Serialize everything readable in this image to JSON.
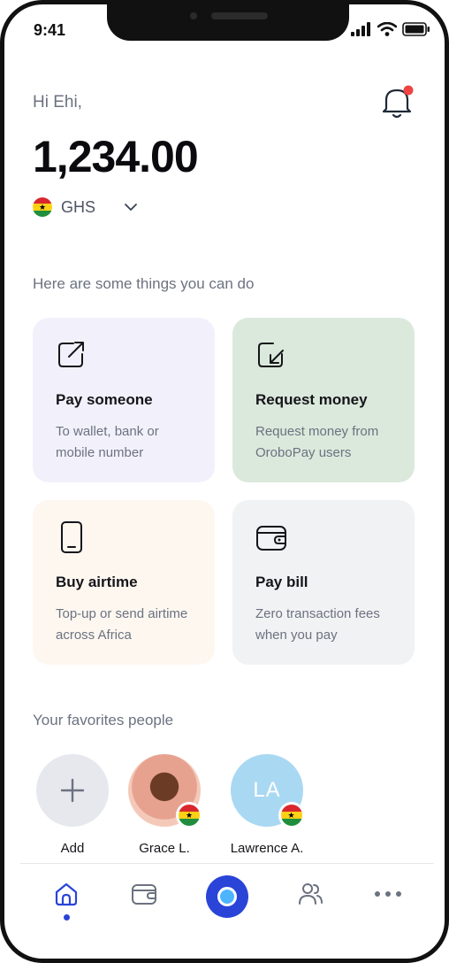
{
  "status_bar": {
    "time": "9:41"
  },
  "header": {
    "greeting": "Hi Ehi,",
    "balance": "1,234.00",
    "currency": "GHS"
  },
  "actions": {
    "title": "Here are some things you can do",
    "items": [
      {
        "title": "Pay someone",
        "description": "To wallet, bank or mobile number",
        "icon": "send-arrow-icon",
        "color": "#f2f1fb"
      },
      {
        "title": "Request money",
        "description": "Request money from OroboPay users",
        "icon": "receive-arrow-icon",
        "color": "#dbe9dc"
      },
      {
        "title": "Buy airtime",
        "description": "Top-up or send airtime across Africa",
        "icon": "phone-icon",
        "color": "#fdf7f0"
      },
      {
        "title": "Pay bill",
        "description": "Zero transaction fees when you pay",
        "icon": "wallet-icon",
        "color": "#f1f2f4"
      }
    ]
  },
  "favorites": {
    "title": "Your favorites people",
    "people": [
      {
        "name": "Add"
      },
      {
        "name": "Grace L."
      },
      {
        "name": "Lawrence A.",
        "initials": "LA"
      }
    ]
  },
  "tab_bar": {
    "items": [
      "home-icon",
      "wallet-icon",
      "scan-icon",
      "people-icon",
      "more-icon"
    ],
    "active": "home-icon",
    "accent": "#2a44d8"
  }
}
